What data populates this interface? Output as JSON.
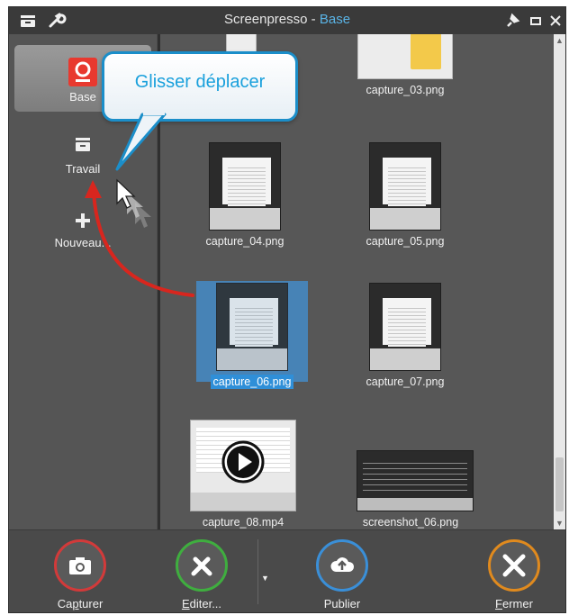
{
  "window": {
    "title_app": "Screenpresso",
    "title_sep": "-",
    "title_workspace": "Base",
    "accent_color": "#5ab4e6"
  },
  "sidebar": {
    "items": [
      {
        "label": "Base",
        "icon": "screenpresso-logo-icon",
        "selected": true
      },
      {
        "label": "Travail",
        "icon": "workspace-drawer-icon",
        "selected": false
      },
      {
        "label": "Nouveau...",
        "icon": "plus-icon",
        "selected": false
      }
    ]
  },
  "files": [
    {
      "name": "capture_03.png"
    },
    {
      "name": "capture_04.png"
    },
    {
      "name": "capture_05.png"
    },
    {
      "name": "capture_06.png",
      "selected": true
    },
    {
      "name": "capture_07.png"
    },
    {
      "name": "capture_08.mp4",
      "video": true
    },
    {
      "name": "screenshot_06.png"
    }
  ],
  "callout": {
    "text": "Glisser déplacer",
    "color": "#1b8ec9"
  },
  "footer": {
    "buttons": [
      {
        "label_pre": "Ca",
        "label_u": "p",
        "label_post": "turer",
        "icon": "camera-icon",
        "ring_color": "#d23a3a"
      },
      {
        "label_pre": "",
        "label_u": "E",
        "label_post": "diter...",
        "icon": "edit-tools-icon",
        "ring_color": "#3fae3f"
      },
      {
        "label_pre": "",
        "label_u": "",
        "label_post": "Publier",
        "icon": "cloud-upload-icon",
        "ring_color": "#3a8fd8"
      },
      {
        "label_pre": "",
        "label_u": "F",
        "label_post": "ermer",
        "icon": "close-icon",
        "ring_color": "#e08a1e"
      }
    ]
  }
}
